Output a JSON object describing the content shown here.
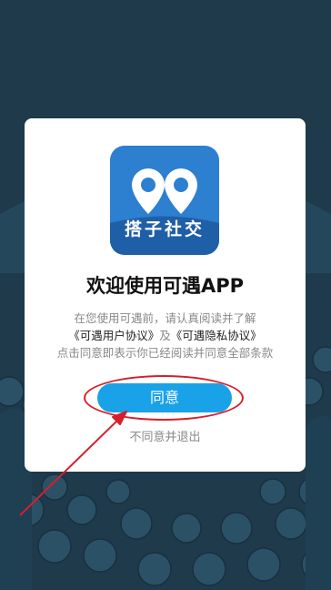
{
  "logo": {
    "label": "搭子社交"
  },
  "dialog": {
    "title": "欢迎使用可遇APP",
    "desc_line1": "在您使用可遇前，请认真阅读并了解",
    "user_agreement": "《可遇用户协议》",
    "and_text": "及",
    "privacy_agreement": "《可遇隐私协议》",
    "desc_line3": "点击同意即表示你已经阅读并同意全部条款",
    "agree_label": "同意",
    "disagree_label": "不同意并退出"
  },
  "colors": {
    "background": "#1e3a4b",
    "button": "#1aa2e8",
    "annotation": "#d61f2a",
    "logo": "#2d7fd0"
  }
}
